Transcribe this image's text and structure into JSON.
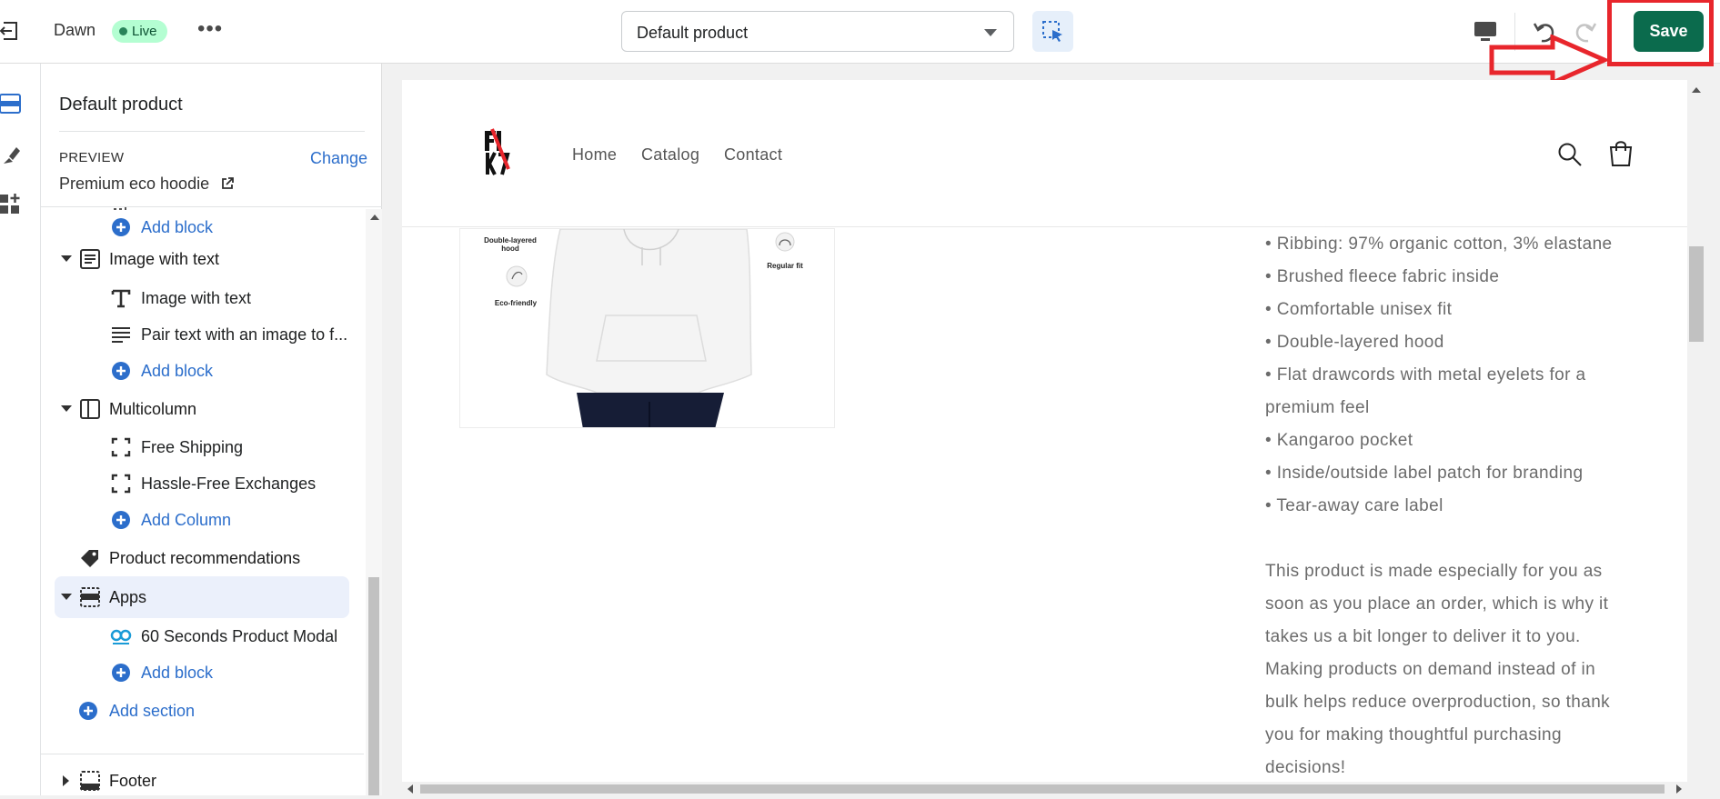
{
  "topbar": {
    "theme_name": "Dawn",
    "status_badge": "Live",
    "template_select": "Default product",
    "save_label": "Save"
  },
  "sidebar": {
    "title": "Default product",
    "preview_label": "PREVIEW",
    "change_link": "Change",
    "preview_value": "Premium eco hoodie",
    "items": [
      {
        "label": "Add block",
        "kind": "add"
      },
      {
        "label": "Image with text",
        "kind": "section",
        "icon": "image-with-text-icon"
      },
      {
        "label": "Image with text",
        "kind": "block",
        "icon": "text-icon"
      },
      {
        "label": "Pair text with an image to f...",
        "kind": "block",
        "icon": "paragraph-icon"
      },
      {
        "label": "Add block",
        "kind": "add"
      },
      {
        "label": "Multicolumn",
        "kind": "section",
        "icon": "columns-icon"
      },
      {
        "label": "Free Shipping",
        "kind": "block",
        "icon": "column-block-icon"
      },
      {
        "label": "Hassle-Free Exchanges",
        "kind": "block",
        "icon": "column-block-icon"
      },
      {
        "label": "Add Column",
        "kind": "add"
      },
      {
        "label": "Product recommendations",
        "kind": "section",
        "icon": "tag-icon"
      },
      {
        "label": "Apps",
        "kind": "section",
        "icon": "apps-section-icon",
        "selected": true
      },
      {
        "label": "60 Seconds Product Modal",
        "kind": "block",
        "icon": "app-logo-icon"
      },
      {
        "label": "Add block",
        "kind": "add"
      },
      {
        "label": "Add section",
        "kind": "add-section"
      },
      {
        "label": "Footer",
        "kind": "section",
        "icon": "footer-icon"
      }
    ]
  },
  "preview": {
    "nav": [
      "Home",
      "Catalog",
      "Contact"
    ],
    "image_captions": {
      "hood": "Double-layered hood",
      "eco": "Eco-friendly",
      "fit": "Regular fit"
    },
    "bullets": [
      "• Ribbing: 97% organic cotton, 3% elastane",
      "• Brushed fleece fabric inside",
      "• Comfortable unisex fit",
      "• Double-layered hood",
      "• Flat drawcords with metal eyelets for a",
      "premium feel",
      "• Kangaroo pocket",
      "• Inside/outside label patch for branding",
      "• Tear-away care label"
    ],
    "paragraph": [
      "This product is made especially for you as",
      "soon as you place an order, which is why it",
      "takes us a bit longer to deliver it to you.",
      "Making products on demand instead of in",
      "bulk helps reduce overproduction, so thank",
      "you for making thoughtful purchasing",
      "decisions!"
    ]
  },
  "colors": {
    "save_button": "#0b6b4d",
    "highlight": "#e8262c",
    "link_blue": "#2c6ecb",
    "live_badge": "#b4fed2"
  }
}
